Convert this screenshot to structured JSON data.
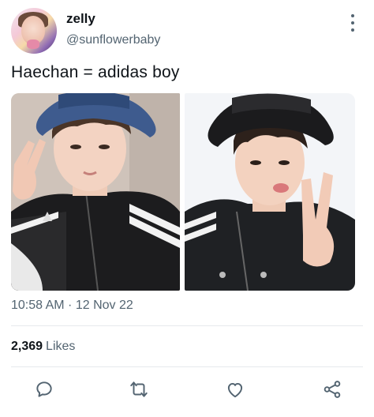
{
  "author": {
    "name": "zelly",
    "handle": "@sunflowerbaby",
    "avatar_icon": "avatar"
  },
  "tweet": {
    "text": "Haechan = adidas boy",
    "media": [
      {
        "description": "selfie-photo-left"
      },
      {
        "description": "selfie-photo-right"
      }
    ],
    "timestamp": "10:58 AM · 12 Nov 22",
    "likes_count": "2,369",
    "likes_label": "Likes"
  },
  "actions": {
    "reply_icon": "reply-icon",
    "retweet_icon": "retweet-icon",
    "like_icon": "heart-icon",
    "share_icon": "share-icon"
  },
  "colors": {
    "text_primary": "#0f1419",
    "text_secondary": "#536471",
    "divider": "#e6e9ec"
  }
}
